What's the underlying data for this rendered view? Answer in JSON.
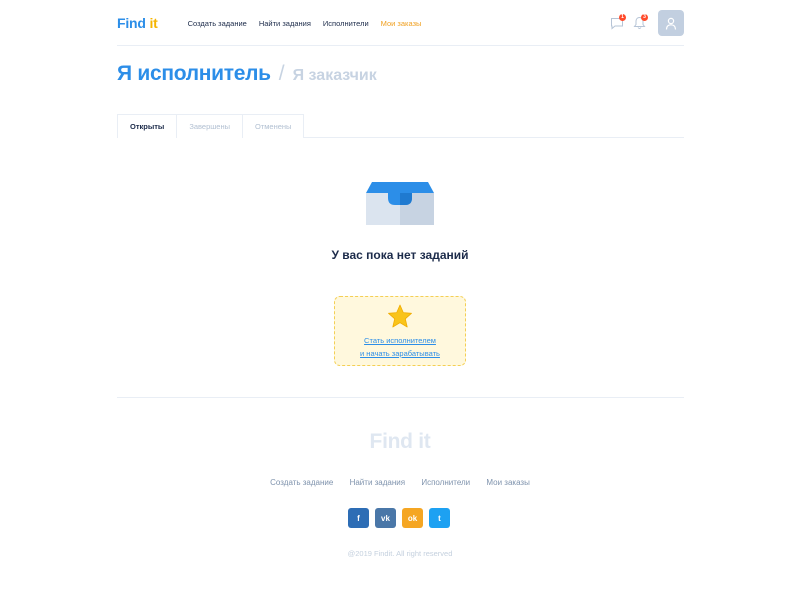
{
  "header": {
    "logo_part1": "Find",
    "logo_part2": " it",
    "nav": [
      {
        "label": "Создать задание"
      },
      {
        "label": "Найти задания"
      },
      {
        "label": "Исполнители"
      },
      {
        "label": "Мои заказы",
        "active": true
      }
    ],
    "messages_badge": "1",
    "notifications_badge": "3"
  },
  "page": {
    "title_active": "Я исполнитель",
    "title_separator": "/",
    "title_inactive": "Я заказчик"
  },
  "tabs": [
    {
      "label": "Открыты",
      "active": true
    },
    {
      "label": "Завершены"
    },
    {
      "label": "Отменены"
    }
  ],
  "empty": {
    "message": "У вас пока нет заданий",
    "promo_line1": "Стать исполнителем",
    "promo_line2": "и начать зарабатывать"
  },
  "footer": {
    "logo": "Find it",
    "nav": [
      {
        "label": "Создать задание"
      },
      {
        "label": "Найти задания"
      },
      {
        "label": "Исполнители"
      },
      {
        "label": "Мои заказы"
      }
    ],
    "social": [
      {
        "icon": "facebook-icon",
        "glyph": "f",
        "color": "#2d6db5"
      },
      {
        "icon": "vk-icon",
        "glyph": "vk",
        "color": "#4a77a8"
      },
      {
        "icon": "odnoklassniki-icon",
        "glyph": "ok",
        "color": "#f5a623"
      },
      {
        "icon": "twitter-icon",
        "glyph": "t",
        "color": "#1da1f2"
      }
    ],
    "copyright": "@2019 Findit. All right reserved"
  },
  "colors": {
    "brand_blue": "#2c8ee8",
    "brand_yellow": "#f5b400",
    "active_orange": "#f0a020"
  }
}
